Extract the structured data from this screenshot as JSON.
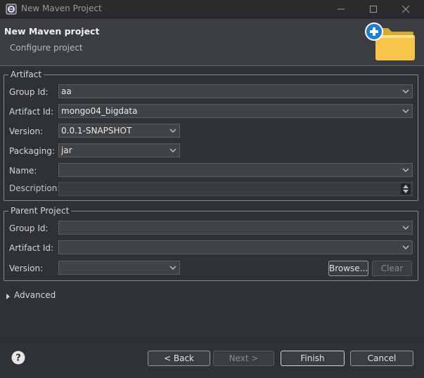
{
  "window": {
    "title": "New Maven Project"
  },
  "header": {
    "title": "New Maven project",
    "subtitle": "Configure project"
  },
  "artifact": {
    "legend": "Artifact",
    "group_id_label": "Group Id:",
    "group_id_value": "aa",
    "artifact_id_label": "Artifact Id:",
    "artifact_id_value": "mongo04_bigdata",
    "version_label": "Version:",
    "version_value": "0.0.1-SNAPSHOT",
    "packaging_label": "Packaging:",
    "packaging_value": "jar",
    "name_label": "Name:",
    "name_value": "",
    "description_label": "Description:",
    "description_value": ""
  },
  "parent": {
    "legend": "Parent Project",
    "group_id_label": "Group Id:",
    "group_id_value": "",
    "artifact_id_label": "Artifact Id:",
    "artifact_id_value": "",
    "version_label": "Version:",
    "version_value": "",
    "browse_label": "Browse...",
    "clear_label": "Clear"
  },
  "advanced": {
    "label": "Advanced",
    "expanded": false
  },
  "footer": {
    "back_label": "< Back",
    "next_label": "Next >",
    "finish_label": "Finish",
    "cancel_label": "Cancel"
  },
  "icons": {
    "app": "eclipse-icon",
    "header": "new-folder-plus-icon",
    "help": "help-icon",
    "dropdown": "chevron-down-icon",
    "advanced": "triangle-right-icon"
  },
  "colors": {
    "background": "#2f3235",
    "header_background": "#3a3d41",
    "field_background": "#404345",
    "folder_yellow": "#f6c54a",
    "plus_blue": "#1a7fd8"
  }
}
